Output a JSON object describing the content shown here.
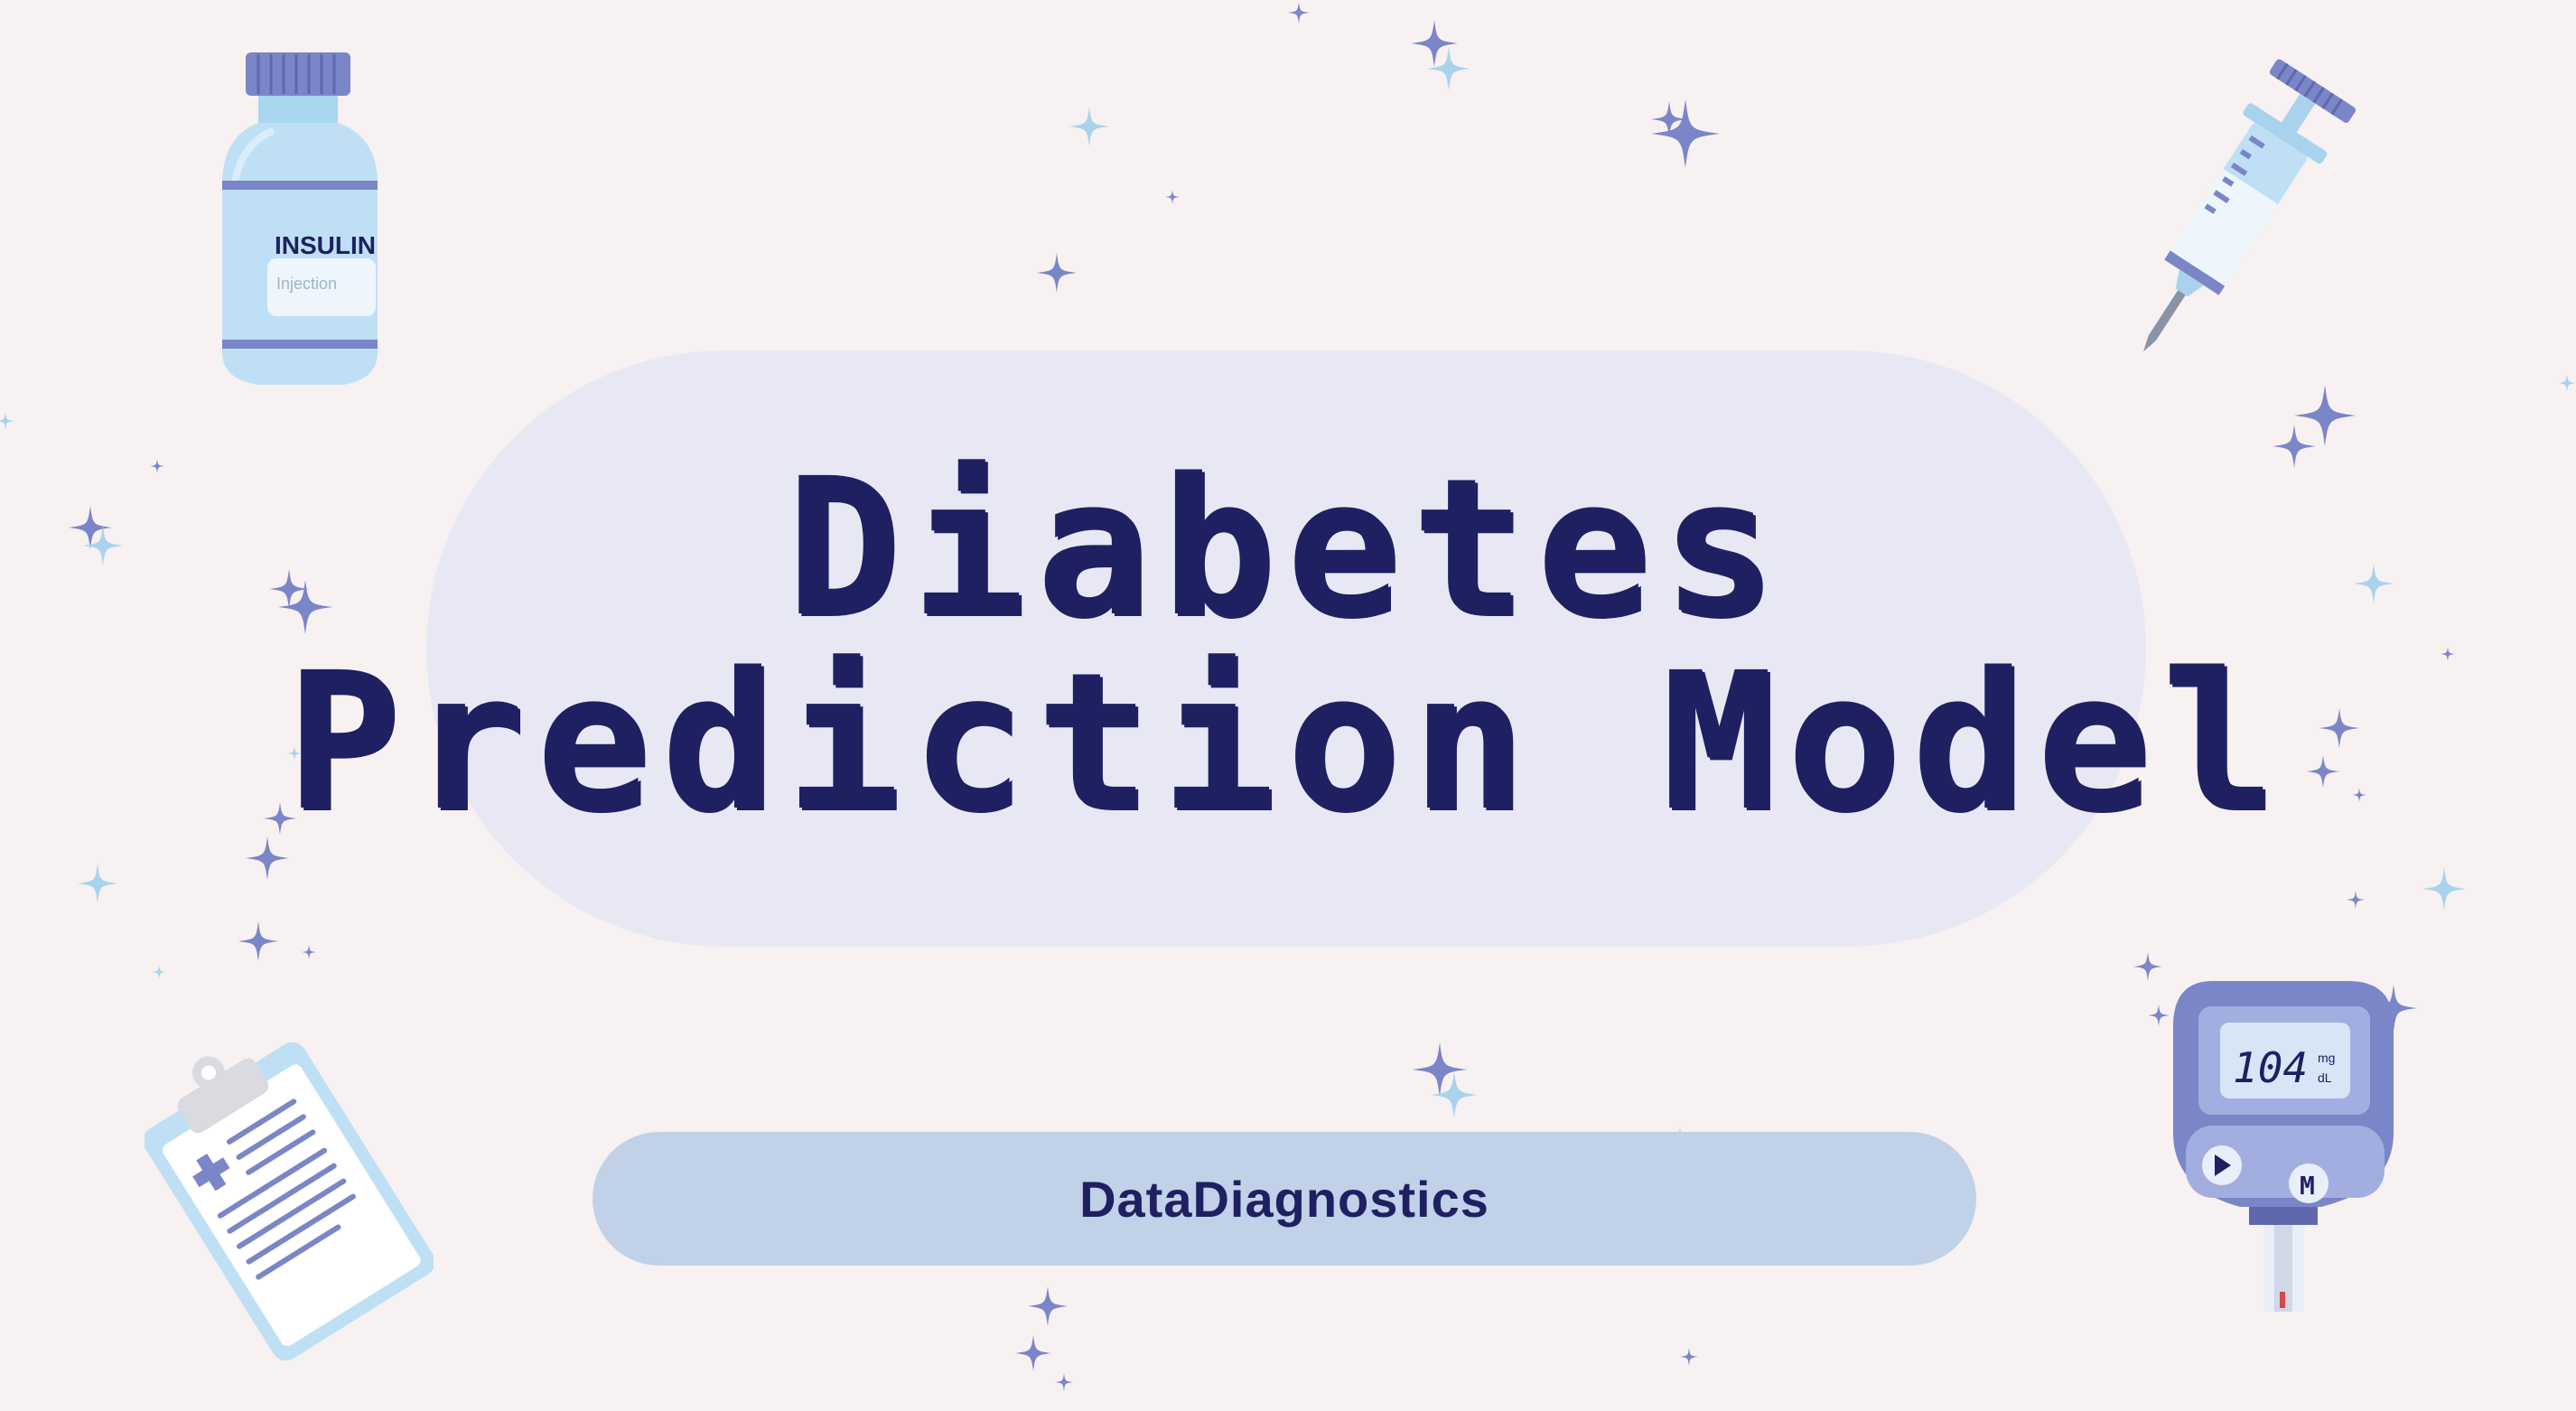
{
  "title": {
    "line1": "Diabetes",
    "line2": "Prediction Model"
  },
  "brand": {
    "name": "DataDiagnostics"
  },
  "insulin_vial": {
    "label": "INSULIN",
    "sublabel": "Injection",
    "icon": "insulin-vial-icon"
  },
  "glucose_meter": {
    "reading": "104",
    "unit_top": "mg",
    "unit_bottom": "dL",
    "button_label": "M",
    "icon": "glucose-meter-icon"
  },
  "syringe": {
    "icon": "syringe-icon"
  },
  "clipboard": {
    "icon": "clipboard-icon"
  },
  "colors": {
    "background": "#f7f1f1",
    "title_pill": "#e8e8f4",
    "brand_pill": "#c0d1e8",
    "ink": "#1f2061",
    "sparkle_dark": "#7b86c8",
    "sparkle_light": "#a9d3ec",
    "device_blue": "#bfe0f4"
  }
}
